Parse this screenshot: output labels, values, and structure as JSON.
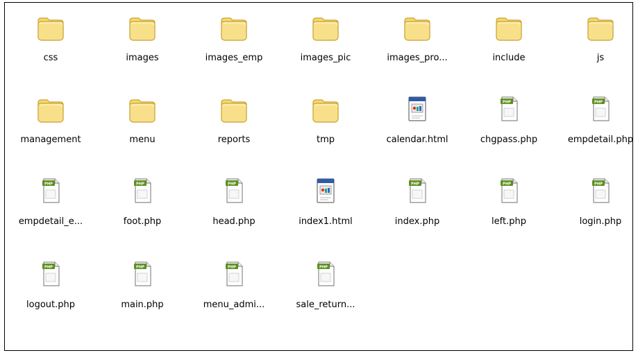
{
  "window": {
    "items": [
      {
        "label": "css",
        "type": "folder"
      },
      {
        "label": "images",
        "type": "folder"
      },
      {
        "label": "images_emp",
        "type": "folder"
      },
      {
        "label": "images_pic",
        "type": "folder"
      },
      {
        "label": "images_pro...",
        "type": "folder"
      },
      {
        "label": "include",
        "type": "folder"
      },
      {
        "label": "js",
        "type": "folder"
      },
      {
        "label": "management",
        "type": "folder"
      },
      {
        "label": "menu",
        "type": "folder"
      },
      {
        "label": "reports",
        "type": "folder"
      },
      {
        "label": "tmp",
        "type": "folder"
      },
      {
        "label": "calendar.html",
        "type": "html"
      },
      {
        "label": "chgpass.php",
        "type": "php"
      },
      {
        "label": "empdetail.php",
        "type": "php"
      },
      {
        "label": "empdetail_e...",
        "type": "php"
      },
      {
        "label": "foot.php",
        "type": "php"
      },
      {
        "label": "head.php",
        "type": "php"
      },
      {
        "label": "index1.html",
        "type": "html"
      },
      {
        "label": "index.php",
        "type": "php"
      },
      {
        "label": "left.php",
        "type": "php"
      },
      {
        "label": "login.php",
        "type": "php"
      },
      {
        "label": "logout.php",
        "type": "php"
      },
      {
        "label": "main.php",
        "type": "php"
      },
      {
        "label": "menu_admi...",
        "type": "php"
      },
      {
        "label": "sale_return...",
        "type": "php"
      }
    ],
    "icons": {
      "folder": "folder-icon",
      "php": "php-file-icon",
      "html": "html-file-icon"
    },
    "php_badge_text": "PHP",
    "php_symbol": "</>",
    "colors": {
      "folder_body": "#f6d86a",
      "folder_edge": "#c9a53a",
      "php_badge": "#5d8f1f",
      "html_header": "#2f5aa8"
    }
  }
}
